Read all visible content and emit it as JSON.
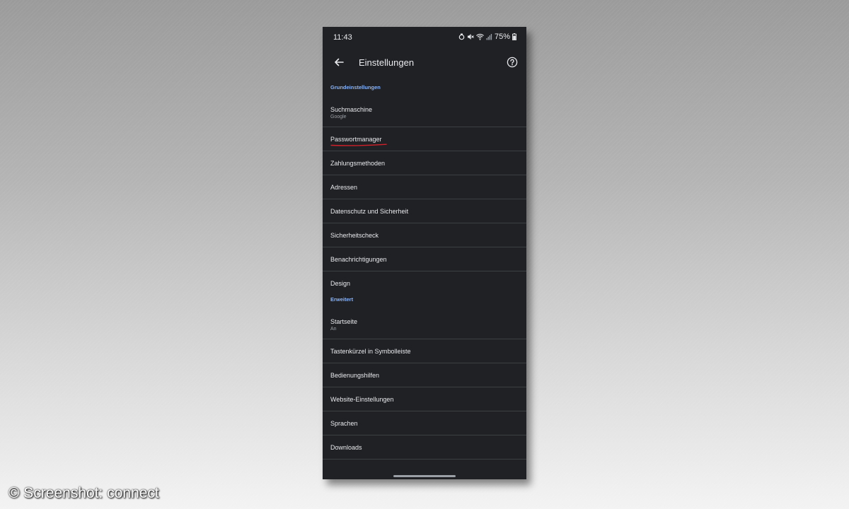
{
  "status_bar": {
    "time": "11:43",
    "battery": "75%",
    "icons": [
      "alarm-icon",
      "mute-icon",
      "wifi-icon",
      "signal-icon",
      "battery-icon"
    ]
  },
  "app_bar": {
    "title": "Einstellungen",
    "back_icon": "back-arrow-icon",
    "help_icon": "help-icon"
  },
  "sections": [
    {
      "header": "Grundeinstellungen",
      "items": [
        {
          "label": "Suchmaschine",
          "sub": "Google"
        },
        {
          "label": "Passwortmanager",
          "highlighted": true
        },
        {
          "label": "Zahlungsmethoden"
        },
        {
          "label": "Adressen"
        },
        {
          "label": "Datenschutz und Sicherheit"
        },
        {
          "label": "Sicherheitscheck"
        },
        {
          "label": "Benachrichtigungen"
        },
        {
          "label": "Design"
        }
      ]
    },
    {
      "header": "Erweitert",
      "items": [
        {
          "label": "Startseite",
          "sub": "An"
        },
        {
          "label": "Tastenkürzel in Symbolleiste"
        },
        {
          "label": "Bedienungshilfen"
        },
        {
          "label": "Website-Einstellungen"
        },
        {
          "label": "Sprachen"
        },
        {
          "label": "Downloads"
        }
      ]
    }
  ],
  "colors": {
    "background": "#202124",
    "section_header": "#8ab4f8",
    "text": "#e8eaed",
    "divider": "#3c4043",
    "annotation": "#d0202a"
  },
  "watermark": "© Screenshot: connect"
}
